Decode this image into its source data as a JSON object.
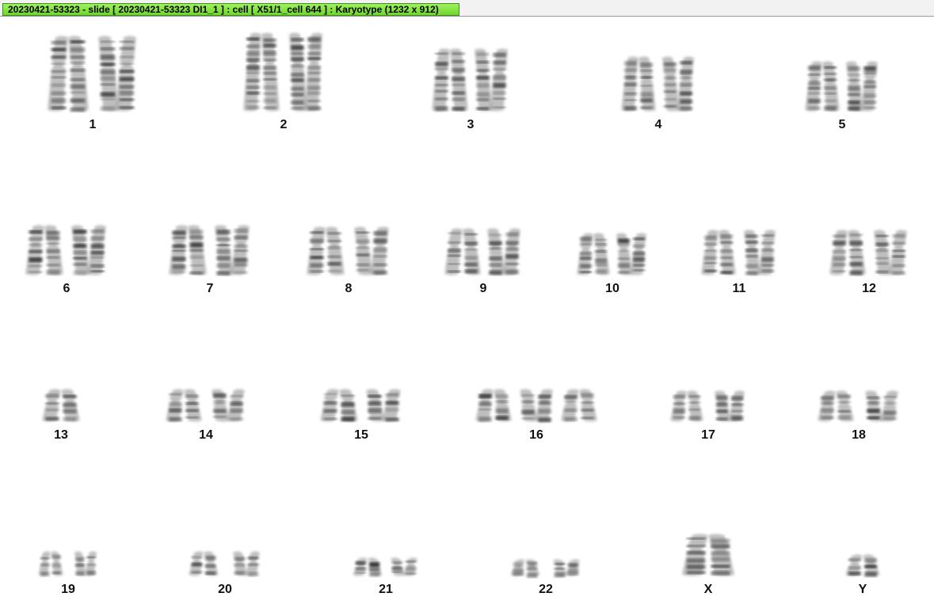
{
  "window": {
    "title": "20230421-53323 - slide [ 20230421-53323 DI1_1 ] : cell [ X51/1_cell 644 ] : Karyotype  (1232 x 912)"
  },
  "chromosomes": [
    {
      "id": "1",
      "label": "1",
      "count": 2
    },
    {
      "id": "2",
      "label": "2",
      "count": 2
    },
    {
      "id": "3",
      "label": "3",
      "count": 2
    },
    {
      "id": "4",
      "label": "4",
      "count": 2
    },
    {
      "id": "5",
      "label": "5",
      "count": 2
    },
    {
      "id": "6",
      "label": "6",
      "count": 2
    },
    {
      "id": "7",
      "label": "7",
      "count": 2
    },
    {
      "id": "8",
      "label": "8",
      "count": 2
    },
    {
      "id": "9",
      "label": "9",
      "count": 2
    },
    {
      "id": "10",
      "label": "10",
      "count": 2
    },
    {
      "id": "11",
      "label": "11",
      "count": 2
    },
    {
      "id": "12",
      "label": "12",
      "count": 2
    },
    {
      "id": "13",
      "label": "13",
      "count": 1
    },
    {
      "id": "14",
      "label": "14",
      "count": 2
    },
    {
      "id": "15",
      "label": "15",
      "count": 2
    },
    {
      "id": "16",
      "label": "16",
      "count": 3
    },
    {
      "id": "17",
      "label": "17",
      "count": 2
    },
    {
      "id": "18",
      "label": "18",
      "count": 2
    },
    {
      "id": "19",
      "label": "19",
      "count": 2
    },
    {
      "id": "20",
      "label": "20",
      "count": 2
    },
    {
      "id": "21",
      "label": "21",
      "count": 2
    },
    {
      "id": "22",
      "label": "22",
      "count": 2
    },
    {
      "id": "x",
      "label": "X",
      "count": 1
    },
    {
      "id": "y",
      "label": "Y",
      "count": 1
    }
  ]
}
